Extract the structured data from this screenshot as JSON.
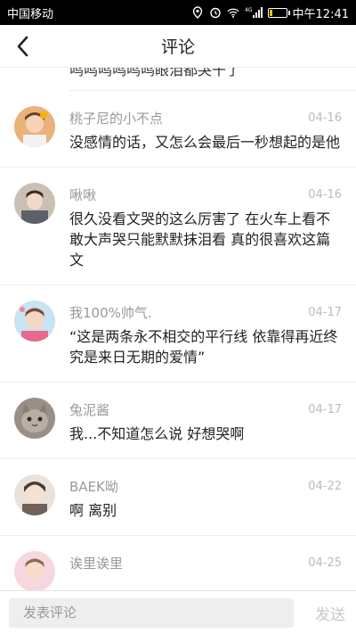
{
  "status_bar": {
    "carrier": "中国移动",
    "time": "中午12:41",
    "icons": [
      "location-icon",
      "alarm-icon",
      "wifi-icon",
      "signal-icon",
      "battery-icon"
    ],
    "network": "4G",
    "battery_level": 0.15
  },
  "header": {
    "title": "评论",
    "back_icon": "chevron-left-icon"
  },
  "partial_comment": {
    "text": "呜呜呜呜呜呜眼泪都哭干了"
  },
  "comments": [
    {
      "user": "桃子尼的小不点",
      "date": "04-16",
      "text": "没感情的话，又怎么会最后一秒想起的是他"
    },
    {
      "user": "啾啾",
      "date": "04-16",
      "text": "很久没看文哭的这么厉害了 在火车上看不敢大声哭只能默默抹泪看 真的很喜欢这篇文"
    },
    {
      "user": "我100%帅气.",
      "date": "04-17",
      "text": "“这是两条永不相交的平行线 依靠得再近终究是来日无期的爱情”"
    },
    {
      "user": "兔泥酱",
      "date": "04-17",
      "text": "我...不知道怎么说 好想哭啊"
    },
    {
      "user": "BAEK呦",
      "date": "04-22",
      "text": "啊 离别"
    },
    {
      "user": "诶里诶里",
      "date": "04-25",
      "text": ""
    }
  ],
  "composer": {
    "placeholder": "发表评论",
    "send_label": "发送"
  },
  "colors": {
    "status_bg": "#000000",
    "username": "#999999",
    "date": "#bbbbbb",
    "divider": "#eeeeee",
    "input_bg": "#eeeeee",
    "send_disabled": "#c8c8c8"
  }
}
